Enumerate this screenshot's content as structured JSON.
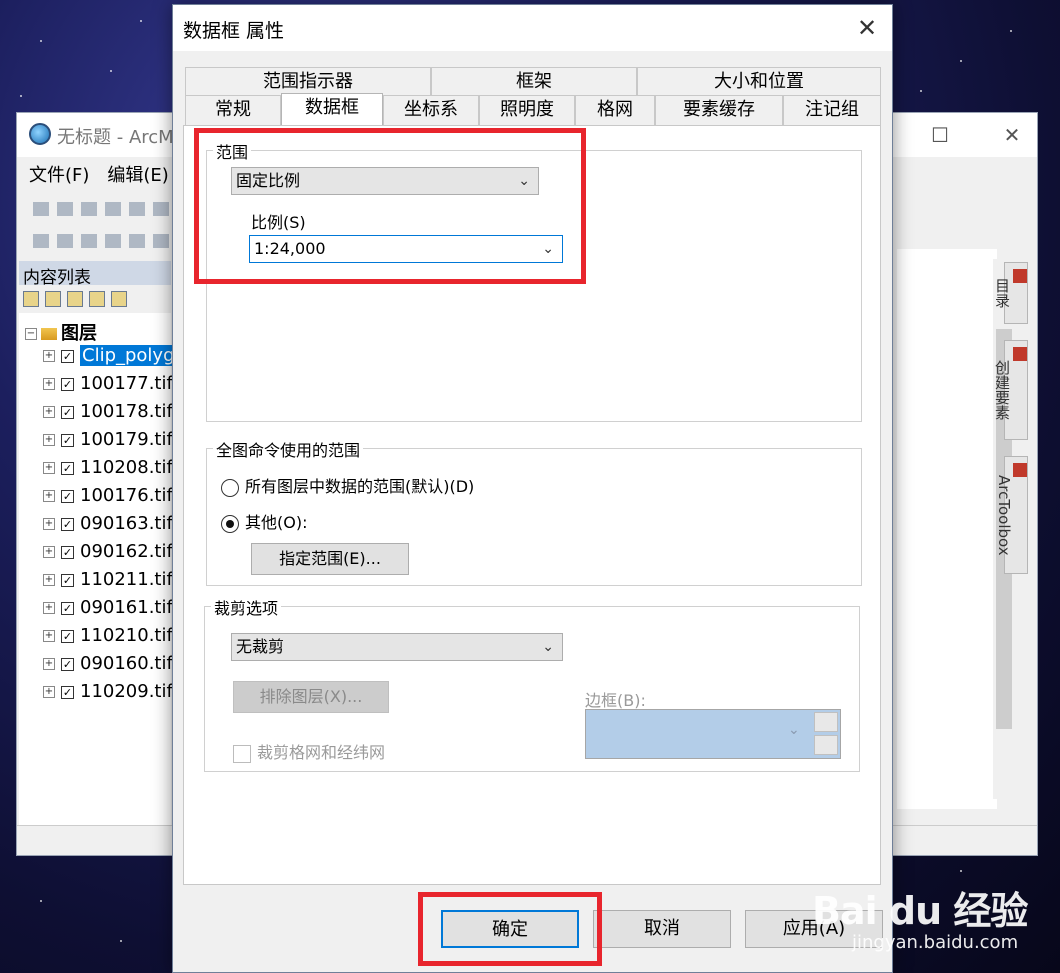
{
  "background_window": {
    "title": "无标题 - ArcM",
    "controls": {
      "maximize": "☐",
      "close": "✕"
    },
    "menu": [
      "文件(F)",
      "编辑(E)"
    ],
    "toc_title": "内容列表",
    "layer_group": "图层",
    "layers": [
      "Clip_polyg",
      "100177.tif",
      "100178.tif",
      "100179.tif",
      "110208.tif",
      "100176.tif",
      "090163.tif",
      "090162.tif",
      "110211.tif",
      "090161.tif",
      "110210.tif",
      "090160.tif",
      "110209.tif"
    ],
    "side_tabs": [
      "目录",
      "创建要素",
      "ArcToolbox"
    ]
  },
  "dialog": {
    "title": "数据框 属性",
    "close": "✕",
    "tabs_row1": [
      "范围指示器",
      "框架",
      "大小和位置"
    ],
    "tabs_row2": [
      "常规",
      "数据框",
      "坐标系",
      "照明度",
      "格网",
      "要素缓存",
      "注记组"
    ],
    "active_tab": "数据框",
    "extent": {
      "group_title": "范围",
      "mode_value": "固定比例",
      "scale_label": "比例(S)",
      "scale_value": "1:24,000"
    },
    "full_extent": {
      "group_title": "全图命令使用的范围",
      "option_default": "所有图层中数据的范围(默认)(D)",
      "option_other": "其他(O):",
      "specify_button": "指定范围(E)..."
    },
    "clip": {
      "group_title": "裁剪选项",
      "clip_value": "无裁剪",
      "exclude_button": "排除图层(X)...",
      "border_label": "边框(B):",
      "clip_grid_label": "裁剪格网和经纬网"
    },
    "buttons": {
      "ok": "确定",
      "cancel": "取消",
      "apply": "应用(A)"
    }
  },
  "watermark": {
    "logo": "Bai du 经验",
    "url": "jingyan.baidu.com"
  },
  "colors": {
    "highlight": "#e8252d",
    "selection": "#0078d7",
    "border_fill": "#b3cde8"
  }
}
